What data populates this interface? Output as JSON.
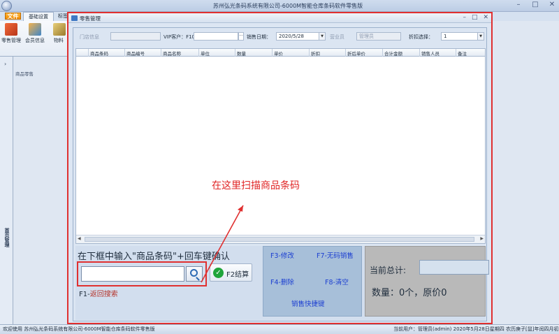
{
  "app": {
    "title": "苏州弘光条码系统有限公司-6000M智能仓库条码软件零售版",
    "file_tab": "文件",
    "tabs": [
      "基础设置",
      "标签"
    ],
    "ribbon": [
      {
        "label": "零售管理",
        "icon": "retail-icon",
        "color": "#d9502c"
      },
      {
        "label": "会员信息",
        "icon": "members-icon",
        "color": "#3f86c8"
      },
      {
        "label": "物料",
        "icon": "material-icon",
        "color": "#c9a34a"
      }
    ],
    "group_label": "商品零售",
    "left_panel_label": "首页管理"
  },
  "window": {
    "title": "零售管理",
    "filter": {
      "store_label": "门店信息",
      "store_value": "",
      "vip_label": "VIP客户：F10",
      "vip_value": "",
      "vip_dots": "···",
      "date_label": "销售日期：",
      "date_value": "2020/5/28",
      "clerk_label": "营业员",
      "clerk_value": "管理员",
      "discount_label": "折扣选择：",
      "discount_value": "1"
    },
    "columns": [
      "商品条码",
      "商品编号",
      "商品名称",
      "单位",
      "数量",
      "单价",
      "折扣",
      "折后单价",
      "合计金额",
      "销售人员",
      "备注"
    ],
    "annotation": "在这里扫描商品条码",
    "hint": "在下框中输入\"商品条码\"+回车键确认",
    "scan_value": "",
    "checkout_label": "F2结算",
    "return_key": "F1-",
    "return_label": "返回搜索",
    "shortcuts": {
      "f3": "F3-修改",
      "f7": "F7-无码销售",
      "f4": "F4-删除",
      "f8": "F8-清空",
      "title": "销售快捷键"
    },
    "totals": {
      "total_label": "当前总计:",
      "total_value": "",
      "count_line": "数量：0个，原价0"
    }
  },
  "status": {
    "left": "欢迎使用 苏州弘光条码系统有限公司-6000M智能仓库条码软件零售版",
    "right": "当前用户：管理员(admin)    2020年5月28日星期四 农历庚子[鼠]年闰四月初六"
  },
  "colors": {
    "accent_red": "#e03030",
    "shortcut_blue": "#1c3fd1",
    "ok_green": "#1fa53a"
  }
}
